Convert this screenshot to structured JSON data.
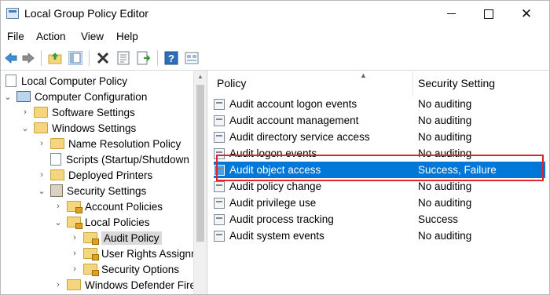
{
  "window": {
    "title": "Local Group Policy Editor"
  },
  "menu": [
    "File",
    "Action",
    "View",
    "Help"
  ],
  "toolbar": {
    "icons": [
      "back-icon",
      "forward-icon",
      "up-folder-icon",
      "show-hide-tree-icon",
      "delete-icon",
      "properties-icon",
      "export-icon",
      "help-icon",
      "filter-icon"
    ]
  },
  "tree": [
    {
      "label": "Local Computer Policy"
    },
    {
      "label": "Computer Configuration"
    },
    {
      "label": "Software Settings"
    },
    {
      "label": "Windows Settings"
    },
    {
      "label": "Name Resolution Policy"
    },
    {
      "label": "Scripts (Startup/Shutdown"
    },
    {
      "label": "Deployed Printers"
    },
    {
      "label": "Security Settings"
    },
    {
      "label": "Account Policies"
    },
    {
      "label": "Local Policies"
    },
    {
      "label": "Audit Policy"
    },
    {
      "label": "User Rights Assignr"
    },
    {
      "label": "Security Options"
    },
    {
      "label": "Windows Defender Fire"
    }
  ],
  "list": {
    "columns": {
      "policy": "Policy",
      "setting": "Security Setting"
    },
    "rows": [
      {
        "policy": "Audit account logon events",
        "setting": "No auditing"
      },
      {
        "policy": "Audit account management",
        "setting": "No auditing"
      },
      {
        "policy": "Audit directory service access",
        "setting": "No auditing"
      },
      {
        "policy": "Audit logon events",
        "setting": "No auditing"
      },
      {
        "policy": "Audit object access",
        "setting": "Success, Failure"
      },
      {
        "policy": "Audit policy change",
        "setting": "No auditing"
      },
      {
        "policy": "Audit privilege use",
        "setting": "No auditing"
      },
      {
        "policy": "Audit process tracking",
        "setting": "Success"
      },
      {
        "policy": "Audit system events",
        "setting": "No auditing"
      }
    ],
    "selected_index": 4
  },
  "colors": {
    "selection": "#0078d7",
    "highlight_box": "#e0242f"
  }
}
